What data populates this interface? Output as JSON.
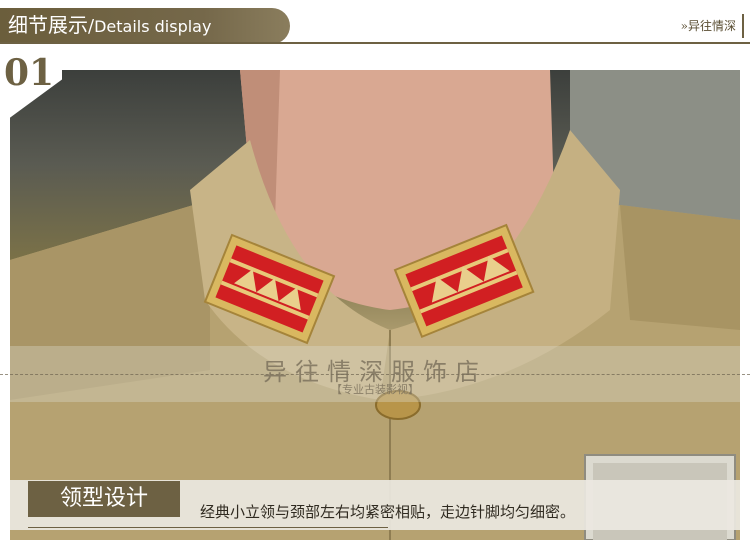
{
  "header": {
    "title_cn": "细节展示",
    "separator": "/",
    "title_en": "Details display",
    "shop_tag": "»异往情深"
  },
  "section": {
    "number": "01"
  },
  "watermark": {
    "main": "异往情深服饰店",
    "sub": "【专业古装影视】"
  },
  "caption": {
    "label": "领型设计",
    "text": "经典小立领与颈部左右均紧密相贴，走边针脚均匀细密。"
  },
  "colors": {
    "brand": "#6d6143",
    "fabric": "#b8a678",
    "badge_red": "#d11f22",
    "badge_gold": "#d9b860"
  }
}
